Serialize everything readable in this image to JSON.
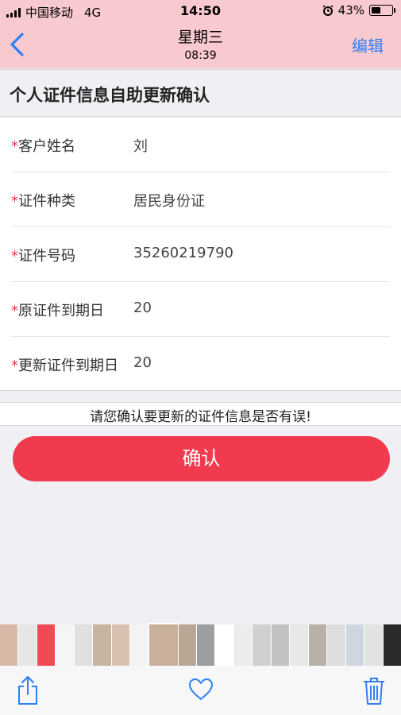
{
  "status_bar": {
    "carrier": "中国移动",
    "network": "4G",
    "time": "14:50",
    "battery": "43%"
  },
  "nav": {
    "back_icon": "chevron-left-icon",
    "title": "星期三",
    "subtitle": "08:39",
    "edit_label": "编辑"
  },
  "page": {
    "heading": "个人证件信息自助更新确认"
  },
  "form": {
    "required_mark": "*",
    "rows": [
      {
        "label": "客户姓名",
        "value": "刘"
      },
      {
        "label": "证件种类",
        "value": "居民身份证"
      },
      {
        "label": "证件号码",
        "value": "35260219790"
      },
      {
        "label": "原证件到期日",
        "value": "20"
      },
      {
        "label": "更新证件到期日",
        "value": "20"
      }
    ]
  },
  "notice": "请您确认要更新的证件信息是否有误!",
  "confirm_button": "确认",
  "thumbnails": [
    "#d9b8a8",
    "#e6e6e6",
    "#f14a55",
    "#f5f5f5",
    "#e0e0e0",
    "#c8b5a0",
    "#d7c0b0",
    "#f3f3f3",
    "#c9b09b",
    "#b9a694",
    "#9e9e9e",
    "#ffffff",
    "#ececec",
    "#d0d0d0",
    "#c2c2c2",
    "#e8e8e8",
    "#b7b2a8",
    "#dedede",
    "#cfd6df",
    "#e2e2e2",
    "#2a2a2a"
  ],
  "colors": {
    "accent_red": "#f13a4e",
    "link_blue": "#2f7ff6",
    "nav_tint": "#f8c9cf"
  },
  "toolbar": {
    "share_icon": "share-icon",
    "like_icon": "heart-icon",
    "delete_icon": "trash-icon"
  }
}
